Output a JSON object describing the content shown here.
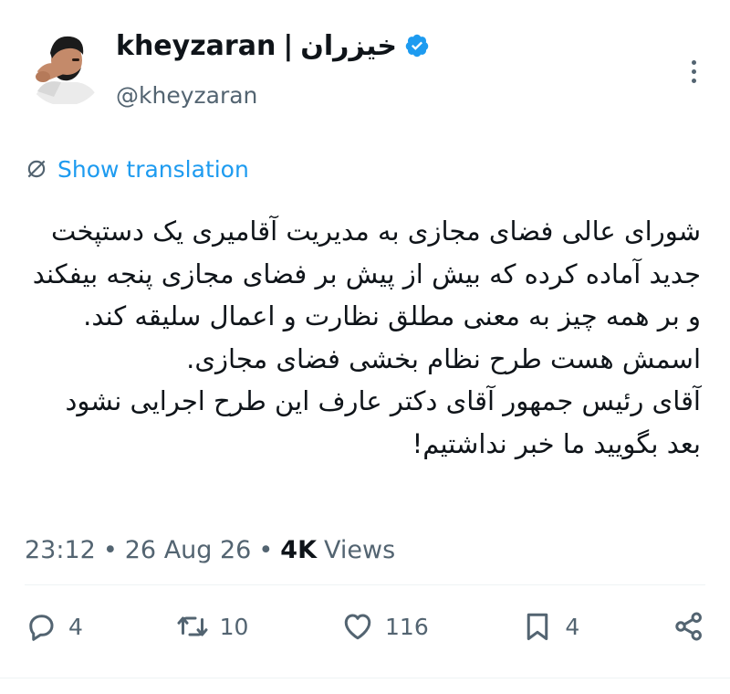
{
  "author": {
    "display_name_en": "kheyzaran",
    "separator": "|",
    "display_name_fa": "خیزران",
    "handle": "@kheyzaran"
  },
  "translate": {
    "label": "Show translation"
  },
  "tweet": {
    "text": "شورای عالی فضای مجازی به مدیریت آقامیری یک دستپخت جدید آماده کرده که بیش از پیش بر فضای مجازی پنجه بیفکند و بر همه چیز به معنی مطلق نظارت و اعمال سلیقه کند. اسمش هست طرح نظام بخشی فضای مجازی.\nآقای رئیس جمهور آقای دکتر عارف این طرح اجرایی نشود بعد بگویید ما خبر نداشتیم!"
  },
  "meta": {
    "time": "23:12",
    "dot1": "•",
    "date": "26 Aug 26",
    "dot2": "•",
    "views_count": "4K",
    "views_label": "Views"
  },
  "actions": {
    "replies": "4",
    "retweets": "10",
    "likes": "116",
    "bookmarks": "4"
  },
  "colors": {
    "accent": "#1d9bf0",
    "text": "#0f1419",
    "secondary": "#536471"
  },
  "icons": {
    "verified": "verified-badge-icon",
    "more": "more-options-icon",
    "translate": "translate-globe-icon",
    "reply": "reply-icon",
    "retweet": "retweet-icon",
    "like": "heart-icon",
    "bookmark": "bookmark-icon",
    "share": "share-icon"
  }
}
